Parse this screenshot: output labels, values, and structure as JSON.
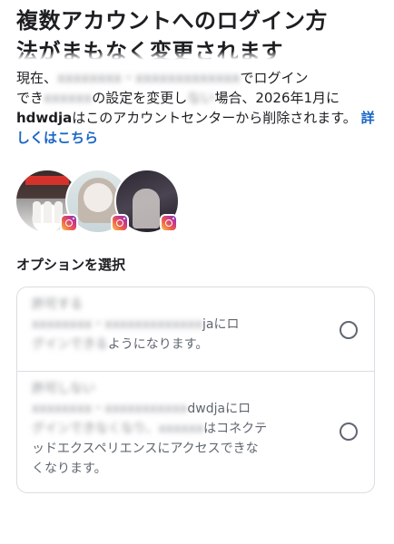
{
  "header": {
    "title_line1": "複数アカウントへのログイン方",
    "title_line2": "法がまもなく変更されます"
  },
  "description": {
    "part1": "現在、",
    "blurred1": "xxxxxxxx・xxxxxxxxxxxxx",
    "part2": "でログイン",
    "part3": "でき",
    "blurred2": "xxxxxx",
    "part4": "の設定を変更し",
    "blurred3": "ない",
    "part5": "場合、2026年1月に",
    "username": "hdwdja",
    "part6": "はこのアカウントセンターから削除されます。",
    "link": "詳しくはこちら"
  },
  "avatars": [
    {
      "name": "account-avatar-1",
      "icon": "instagram-icon"
    },
    {
      "name": "account-avatar-2",
      "icon": "instagram-icon"
    },
    {
      "name": "account-avatar-3",
      "icon": "instagram-icon"
    }
  ],
  "options_title": "オプションを選択",
  "options": [
    {
      "label_blurred": "許可する",
      "line1_blurred": "xxxxxxxx・xxxxxxxxxxxxx",
      "line1_visible": "jaにロ",
      "line2_blurred": "グインできる",
      "line2_visible": "ようになります。"
    },
    {
      "label_blurred": "許可しない",
      "line1_blurred": "xxxxxxxx・xxxxxxxxxxx",
      "line1_visible": "dwdjaにロ",
      "line2_blurred": "グインできなくなり、xxxxxx",
      "line2_visible": "はコネクテ",
      "line3": "ッドエクスペリエンスにアクセスできな",
      "line4": "くなります。"
    }
  ],
  "colors": {
    "link": "#1a66c7",
    "border": "#dadde1",
    "text": "#1c1e21",
    "secondary": "#606770"
  }
}
